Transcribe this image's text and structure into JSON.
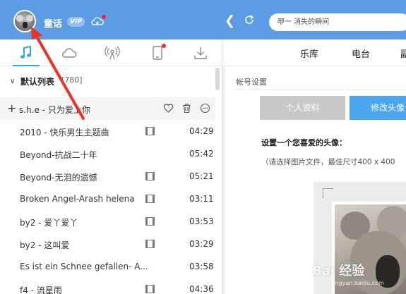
{
  "header": {
    "username": "童话",
    "vip_badge": "VIP",
    "search_placeholder": "咿一 消失的瞬间",
    "accent_color": "#5c9ce4"
  },
  "left_tabs": [
    "music-note-icon",
    "cloud-icon",
    "radio-icon",
    "phone-icon",
    "download-icon"
  ],
  "playlist": {
    "title": "默认列表",
    "count": "[780]",
    "now_playing": "s.h.e - 只为爱上你",
    "songs": [
      {
        "name": "2010 - 快乐男生主题曲",
        "time": "04:29",
        "mv": true
      },
      {
        "name": "Beyond-抗战二十年",
        "time": "05:42",
        "mv": false
      },
      {
        "name": "Beyond-无泪的遗憾",
        "time": "05:21",
        "mv": true
      },
      {
        "name": "Broken Angel-Arash helena",
        "time": "03:11",
        "mv": true
      },
      {
        "name": "by2 - 爱丫爱丫",
        "time": "03:53",
        "mv": true
      },
      {
        "name": "by2 - 这叫爱",
        "time": "03:29",
        "mv": true
      },
      {
        "name": "Es ist ein Schnee gefallen- A...",
        "time": "03:58",
        "mv": false
      },
      {
        "name": "f4 - 流星雨",
        "time": "04:36",
        "mv": true
      }
    ]
  },
  "right": {
    "nav": [
      "乐库",
      "电台",
      "副"
    ],
    "breadcrumb": "帐号设置",
    "tab_personal": "个人资料",
    "tab_avatar": "修改头像",
    "subtitle": "设置一个您喜爱的头像：",
    "hint": "（请选择图片文件，最佳尺寸400 x 400"
  },
  "watermark": {
    "brand": "Bai 经验",
    "sub": "jingyan.baidu.com"
  }
}
